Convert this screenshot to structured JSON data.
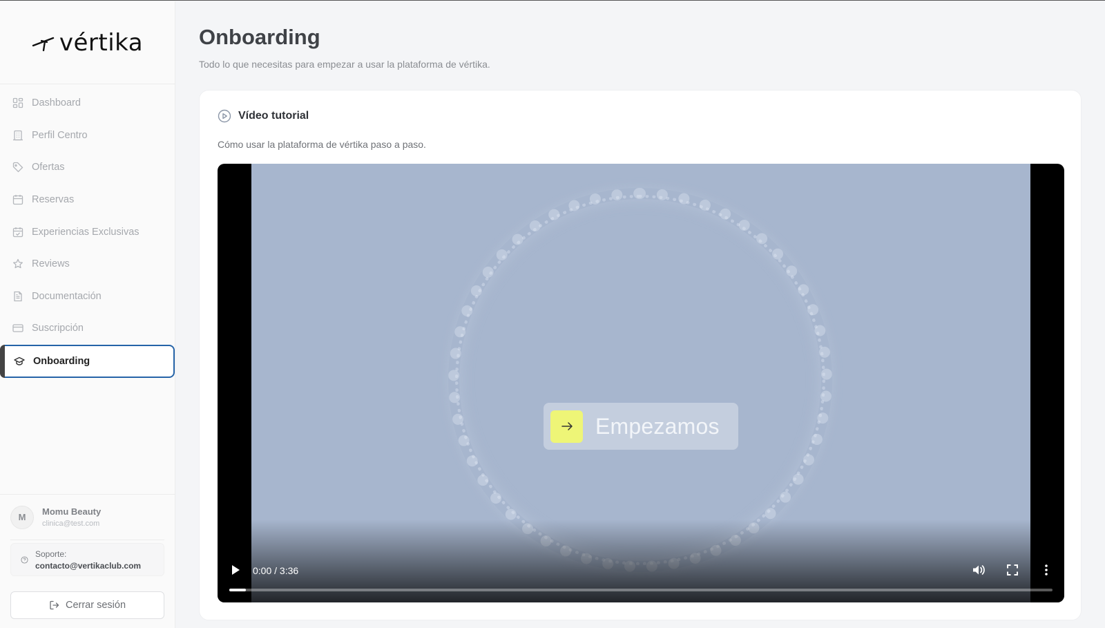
{
  "brand": {
    "name": "vértika"
  },
  "sidebar": {
    "items": [
      {
        "label": "Dashboard",
        "icon": "dashboard-icon",
        "active": false
      },
      {
        "label": "Perfil Centro",
        "icon": "building-icon",
        "active": false
      },
      {
        "label": "Ofertas",
        "icon": "tag-icon",
        "active": false
      },
      {
        "label": "Reservas",
        "icon": "calendar-icon",
        "active": false
      },
      {
        "label": "Experiencias Exclusivas",
        "icon": "calendar-check-icon",
        "active": false
      },
      {
        "label": "Reviews",
        "icon": "star-icon",
        "active": false
      },
      {
        "label": "Documentación",
        "icon": "document-icon",
        "active": false
      },
      {
        "label": "Suscripción",
        "icon": "credit-card-icon",
        "active": false
      },
      {
        "label": "Onboarding",
        "icon": "graduation-cap-icon",
        "active": true
      }
    ],
    "user": {
      "initial": "M",
      "name": "Momu Beauty",
      "email": "clinica@test.com"
    },
    "support": {
      "label": "Soporte:",
      "email": "contacto@vertikaclub.com"
    },
    "logout_label": "Cerrar sesión"
  },
  "main": {
    "title": "Onboarding",
    "subtitle": "Todo lo que necesitas para empezar a usar la plataforma de vértika.",
    "card": {
      "title": "Vídeo tutorial",
      "description": "Cómo usar la plataforma de vértika paso a paso.",
      "video": {
        "overlay_text": "Empezamos",
        "time": "0:00 / 3:36",
        "progress": 0.02
      }
    }
  },
  "colors": {
    "accent_active_border": "#2563a8",
    "video_bg": "#a7b6ce",
    "cta_arrow": "#eef577"
  }
}
